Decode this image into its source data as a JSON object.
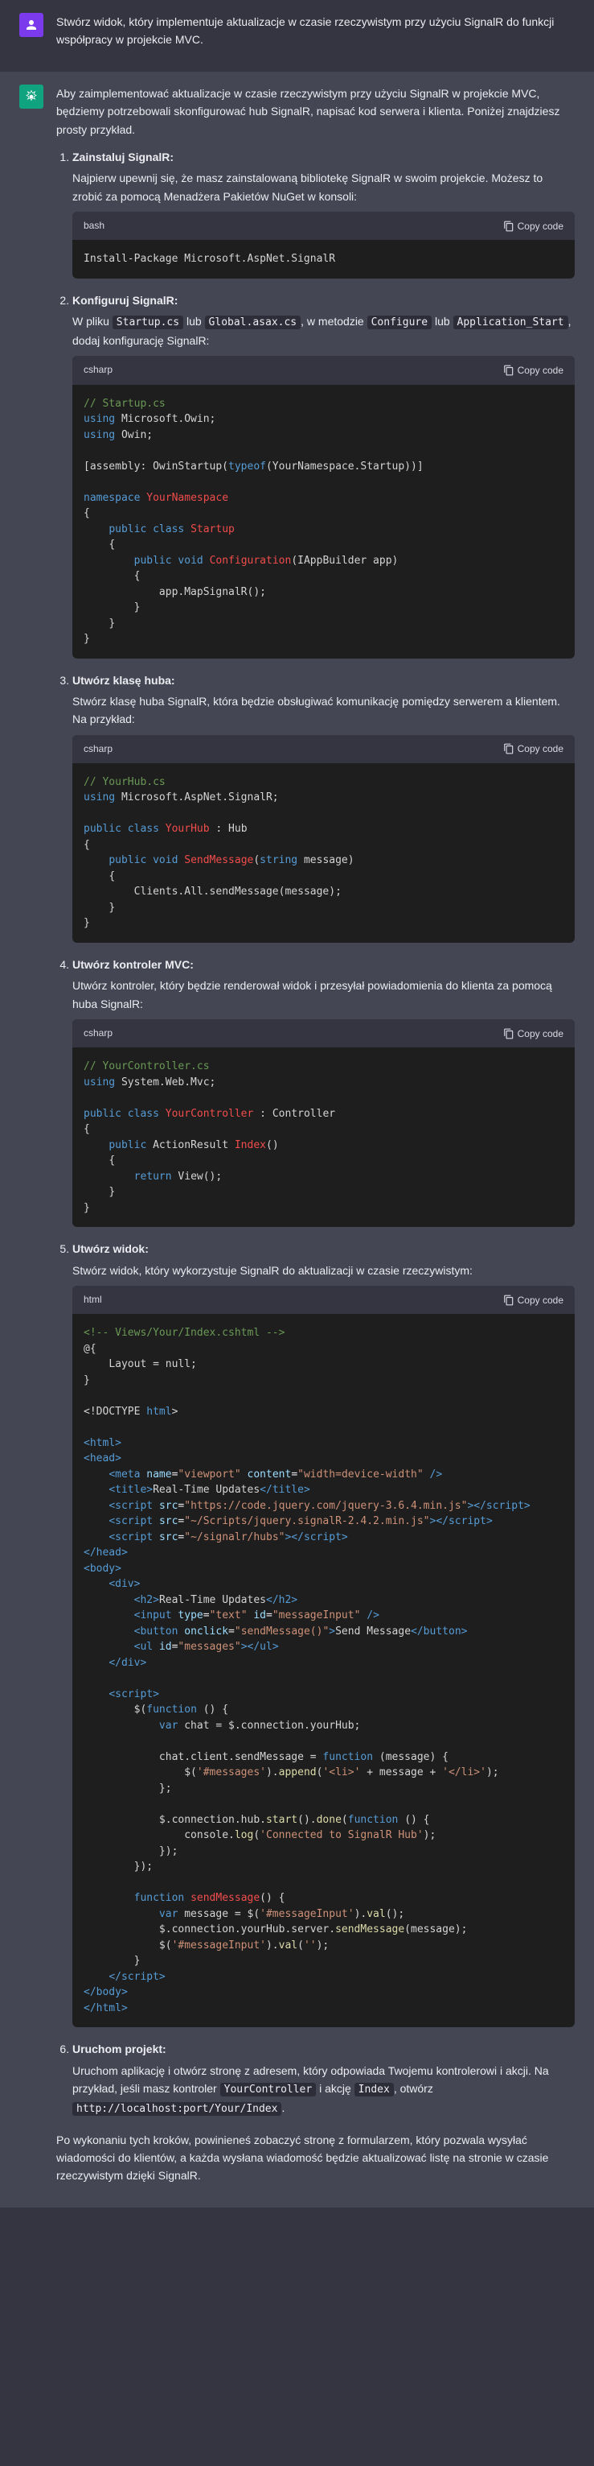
{
  "user_message": "Stwórz widok, który implementuje aktualizacje w czasie rzeczywistym przy użyciu SignalR do funkcji współpracy w projekcie MVC.",
  "intro": "Aby zaimplementować aktualizacje w czasie rzeczywistym przy użyciu SignalR w projekcie MVC, będziemy potrzebowali skonfigurować hub SignalR, napisać kod serwera i klienta. Poniżej znajdziesz prosty przykład.",
  "copy_label": "Copy code",
  "lang": {
    "bash": "bash",
    "csharp": "csharp",
    "html": "html"
  },
  "steps": [
    {
      "title": "Zainstaluj SignalR:",
      "desc": "Najpierw upewnij się, że masz zainstalowaną bibliotekę SignalR w swoim projekcie. Możesz to zrobić za pomocą Menadżera Pakietów NuGet w konsoli:"
    },
    {
      "title": "Konfiguruj SignalR:",
      "desc_pre": "W pliku ",
      "code1": "Startup.cs",
      "desc_mid": " lub ",
      "code2": "Global.asax.cs",
      "desc_mid2": ", w metodzie ",
      "code3": "Configure",
      "desc_mid3": " lub ",
      "code4": "Application_Start",
      "desc_end": ", dodaj konfigurację SignalR:"
    },
    {
      "title": "Utwórz klasę huba:",
      "desc": "Stwórz klasę huba SignalR, która będzie obsługiwać komunikację pomiędzy serwerem a klientem. Na przykład:"
    },
    {
      "title": "Utwórz kontroler MVC:",
      "desc": "Utwórz kontroler, który będzie renderował widok i przesyłał powiadomienia do klienta za pomocą huba SignalR:"
    },
    {
      "title": "Utwórz widok:",
      "desc": "Stwórz widok, który wykorzystuje SignalR do aktualizacji w czasie rzeczywistym:"
    },
    {
      "title": "Uruchom projekt:",
      "desc_pre": "Uruchom aplikację i otwórz stronę z adresem, który odpowiada Twojemu kontrolerowi i akcji. Na przykład, jeśli masz kontroler ",
      "code1": "YourController",
      "desc_mid": " i akcję ",
      "code2": "Index",
      "desc_mid2": ", otwórz ",
      "code3": "http://localhost:port/Your/Index",
      "desc_end": "."
    }
  ],
  "outro": "Po wykonaniu tych kroków, powinieneś zobaczyć stronę z formularzem, który pozwala wysyłać wiadomości do klientów, a każda wysłana wiadomość będzie aktualizować listę na stronie w czasie rzeczywistym dzięki SignalR.",
  "code": {
    "bash": "Install-Package Microsoft.AspNet.SignalR",
    "startup_comment": "// Startup.cs",
    "hub_comment": "// YourHub.cs",
    "ctrl_comment": "// YourController.cs",
    "view_comment": "<!-- Views/Your/Index.cshtml -->"
  }
}
